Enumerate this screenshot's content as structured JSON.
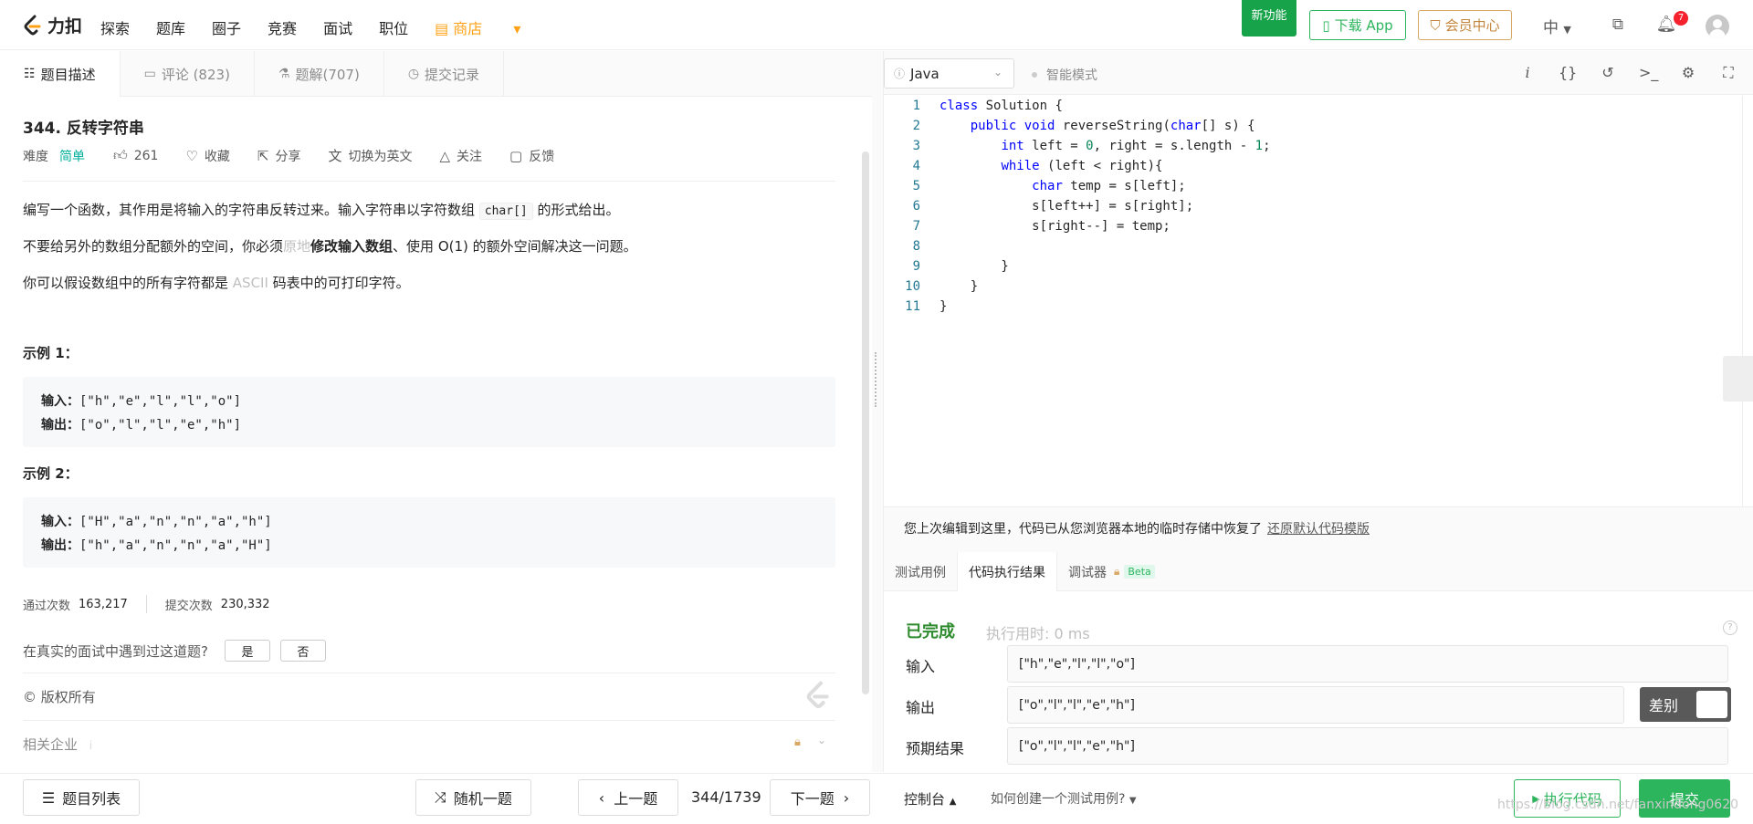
{
  "nav": {
    "logo_text": "力扣",
    "links": [
      "探索",
      "题库",
      "圈子",
      "竞赛",
      "面试",
      "职位"
    ],
    "shop": "商店",
    "new_feature": "新功能",
    "download": "下载 App",
    "vip": "会员中心",
    "lang": "中",
    "notif_count": "7"
  },
  "left_tabs": [
    {
      "label": "题目描述",
      "icon": "description-icon"
    },
    {
      "label": "评论 (823)",
      "icon": "comment-icon"
    },
    {
      "label": "题解(707)",
      "icon": "flask-icon"
    },
    {
      "label": "提交记录",
      "icon": "clock-icon"
    }
  ],
  "problem": {
    "title": "344. 反转字符串",
    "difficulty_label": "难度",
    "difficulty": "简单",
    "likes": "261",
    "actions": [
      "收藏",
      "分享",
      "切换为英文",
      "关注",
      "反馈"
    ],
    "p1_a": "编写一个函数，其作用是将输入的字符串反转过来。输入字符串以字符数组 ",
    "p1_code": "char[]",
    "p1_b": " 的形式给出。",
    "p2_a": "不要给另外的数组分配额外的空间，你必须",
    "p2_light": "原地",
    "p2_bold": "修改输入数组",
    "p2_b": "、使用 O(1) 的额外空间解决这一问题。",
    "p3_a": "你可以假设数组中的所有字符都是 ",
    "p3_light": "ASCII",
    "p3_b": " 码表中的可打印字符。",
    "ex1_title": "示例 1：",
    "ex1_in_label": "输入：",
    "ex1_in": "[\"h\",\"e\",\"l\",\"l\",\"o\"]",
    "ex1_out_label": "输出：",
    "ex1_out": "[\"o\",\"l\",\"l\",\"e\",\"h\"]",
    "ex2_title": "示例 2：",
    "ex2_in_label": "输入：",
    "ex2_in": "[\"H\",\"a\",\"n\",\"n\",\"a\",\"h\"]",
    "ex2_out_label": "输出：",
    "ex2_out": "[\"h\",\"a\",\"n\",\"n\",\"a\",\"H\"]",
    "pass_label": "通过次数",
    "pass_count": "163,217",
    "submit_label": "提交次数",
    "submit_count": "230,332",
    "ask": "在真实的面试中遇到过这道题?",
    "yes": "是",
    "no": "否",
    "copyright": "© 版权所有",
    "related": "相关企业"
  },
  "editor": {
    "language": "Java",
    "smart_mode": "智能模式",
    "lines": [
      "1",
      "2",
      "3",
      "4",
      "5",
      "6",
      "7",
      "8",
      "9",
      "10",
      "11"
    ]
  },
  "restore": {
    "message": "您上次编辑到这里，代码已从您浏览器本地的临时存储中恢复了",
    "link": "还原默认代码模版"
  },
  "result_tabs": [
    "测试用例",
    "代码执行结果",
    "调试器"
  ],
  "beta": "Beta",
  "result": {
    "status": "已完成",
    "time": "执行用时: 0 ms",
    "input_label": "输入",
    "input": "[\"h\",\"e\",\"l\",\"l\",\"o\"]",
    "output_label": "输出",
    "output": "[\"o\",\"l\",\"l\",\"e\",\"h\"]",
    "expected_label": "预期结果",
    "expected": "[\"o\",\"l\",\"l\",\"e\",\"h\"]",
    "diff": "差别"
  },
  "bottom": {
    "list": "题目列表",
    "random": "随机一题",
    "prev": "上一题",
    "page": "344/1739",
    "next": "下一题",
    "console": "控制台",
    "howto": "如何创建一个测试用例?",
    "run": "执行代码",
    "submit": "提交",
    "watermark": "https://blog.csdn.net/fanxindong0620"
  },
  "colors": {
    "brand": "#ffa116",
    "green": "#2db55d",
    "easy": "#00af9b"
  }
}
